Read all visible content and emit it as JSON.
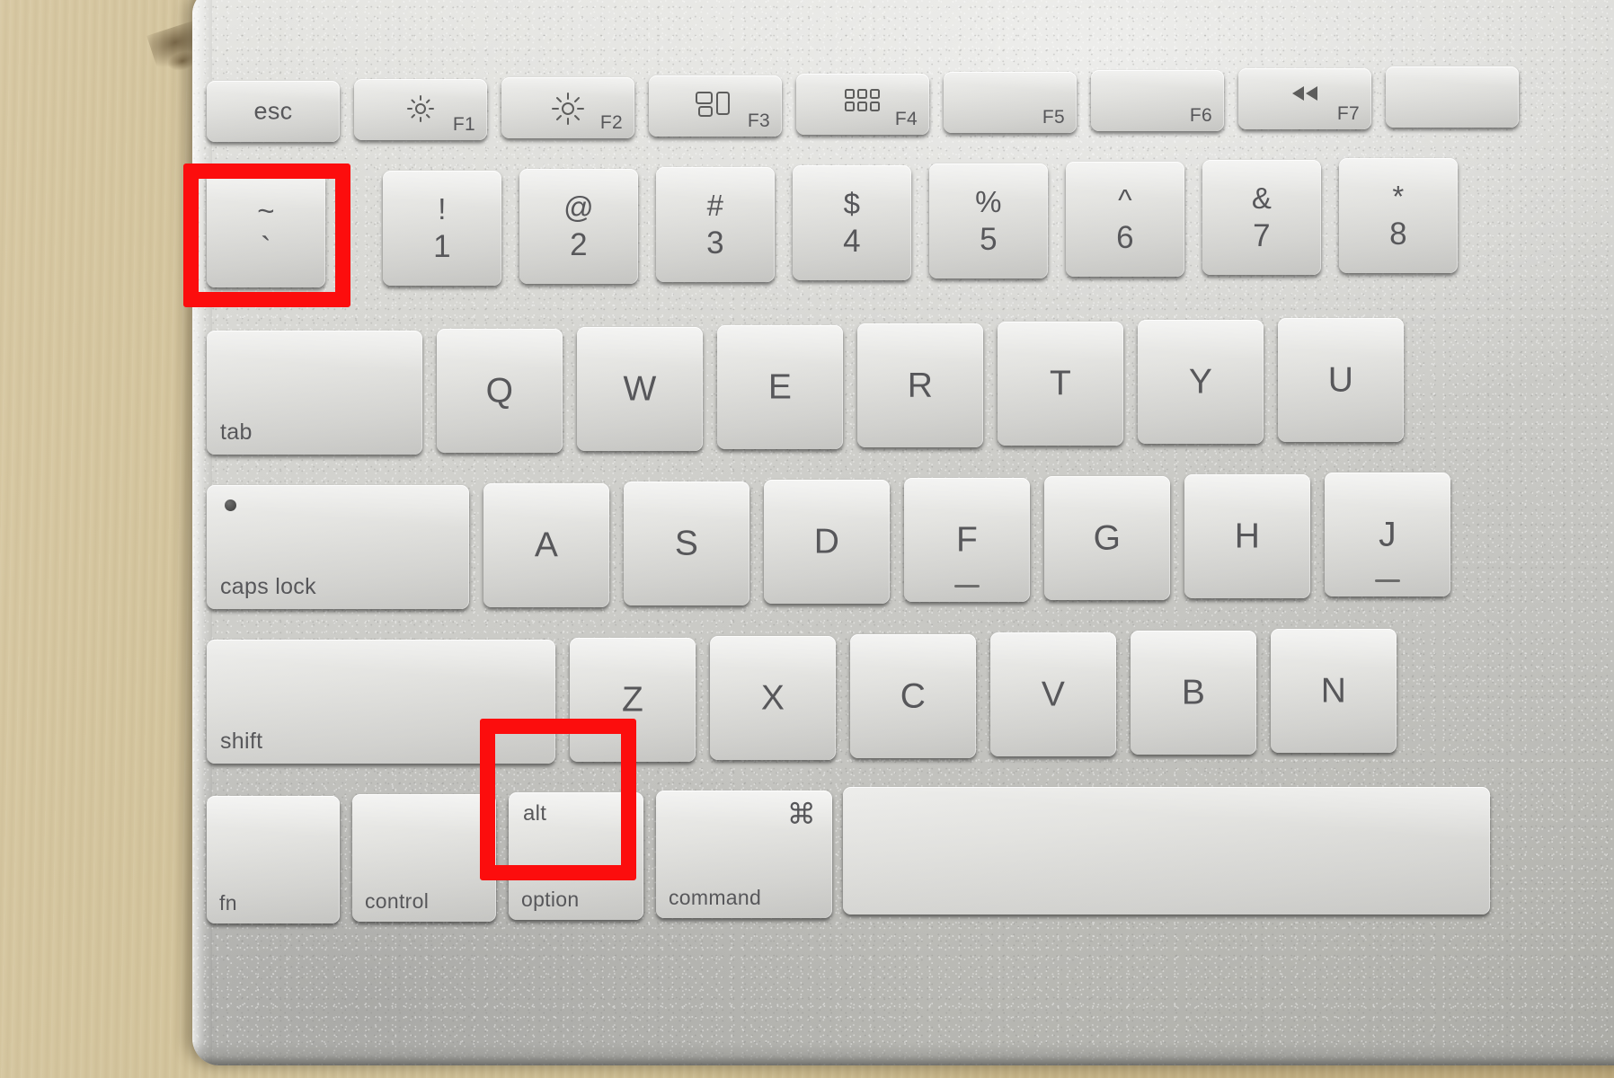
{
  "image": {
    "subject": "Apple aluminium wireless keyboard photographed on a light wood desk",
    "background_color": "#cdbd92",
    "chassis_color": "#d2d2ce",
    "key_color": "#e3e3e0",
    "legend_color": "#57575a",
    "highlight_color": "#fc0d0d"
  },
  "annotations": [
    {
      "name": "tilde-key-highlight",
      "target_key": "~ `",
      "label": ""
    },
    {
      "name": "option-key-highlight",
      "target_key": "alt option",
      "label": ""
    }
  ],
  "rows": {
    "function_row": [
      {
        "name": "esc",
        "main": "esc",
        "fn": "",
        "icon": ""
      },
      {
        "name": "f1",
        "main": "",
        "fn": "F1",
        "icon": "brightness-down-icon"
      },
      {
        "name": "f2",
        "main": "",
        "fn": "F2",
        "icon": "brightness-up-icon"
      },
      {
        "name": "f3",
        "main": "",
        "fn": "F3",
        "icon": "mission-control-icon"
      },
      {
        "name": "f4",
        "main": "",
        "fn": "F4",
        "icon": "launchpad-icon"
      },
      {
        "name": "f5",
        "main": "",
        "fn": "F5",
        "icon": ""
      },
      {
        "name": "f6",
        "main": "",
        "fn": "F6",
        "icon": ""
      },
      {
        "name": "f7",
        "main": "",
        "fn": "F7",
        "icon": "rewind-icon"
      },
      {
        "name": "f8",
        "main": "",
        "fn": "",
        "icon": ""
      }
    ],
    "number_row": [
      {
        "name": "tilde",
        "upper": "~",
        "lower": "`"
      },
      {
        "name": "one",
        "upper": "!",
        "lower": "1"
      },
      {
        "name": "two",
        "upper": "@",
        "lower": "2"
      },
      {
        "name": "three",
        "upper": "#",
        "lower": "3"
      },
      {
        "name": "four",
        "upper": "$",
        "lower": "4"
      },
      {
        "name": "five",
        "upper": "%",
        "lower": "5"
      },
      {
        "name": "six",
        "upper": "^",
        "lower": "6"
      },
      {
        "name": "seven",
        "upper": "&",
        "lower": "7"
      },
      {
        "name": "eight",
        "upper": "*",
        "lower": "8"
      }
    ],
    "qwerty_row": [
      {
        "name": "tab",
        "label": "tab"
      },
      {
        "name": "q",
        "label": "Q"
      },
      {
        "name": "w",
        "label": "W"
      },
      {
        "name": "e",
        "label": "E"
      },
      {
        "name": "r",
        "label": "R"
      },
      {
        "name": "t",
        "label": "T"
      },
      {
        "name": "y",
        "label": "Y"
      },
      {
        "name": "u",
        "label": "U"
      }
    ],
    "home_row": [
      {
        "name": "caps-lock",
        "label": "caps lock"
      },
      {
        "name": "a",
        "label": "A"
      },
      {
        "name": "s",
        "label": "S"
      },
      {
        "name": "d",
        "label": "D"
      },
      {
        "name": "f",
        "label": "F"
      },
      {
        "name": "g",
        "label": "G"
      },
      {
        "name": "h",
        "label": "H"
      },
      {
        "name": "j",
        "label": "J"
      }
    ],
    "shift_row": [
      {
        "name": "shift",
        "label": "shift"
      },
      {
        "name": "z",
        "label": "Z"
      },
      {
        "name": "x",
        "label": "X"
      },
      {
        "name": "c",
        "label": "C"
      },
      {
        "name": "v",
        "label": "V"
      },
      {
        "name": "b",
        "label": "B"
      },
      {
        "name": "n",
        "label": "N"
      }
    ],
    "bottom_row": [
      {
        "name": "fn",
        "top": "",
        "bottom": "fn"
      },
      {
        "name": "control",
        "top": "",
        "bottom": "control"
      },
      {
        "name": "option",
        "top": "alt",
        "bottom": "option"
      },
      {
        "name": "command",
        "top": "⌘",
        "bottom": "command"
      },
      {
        "name": "space",
        "top": "",
        "bottom": ""
      }
    ]
  }
}
